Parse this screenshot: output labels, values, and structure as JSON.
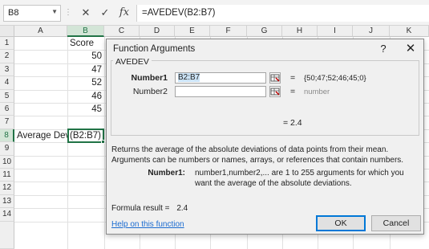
{
  "formula_bar": {
    "name_box": "B8",
    "cancel_glyph": "✕",
    "enter_glyph": "✓",
    "fx_label": "fx",
    "formula": "=AVEDEV(B2:B7)"
  },
  "columns": [
    "A",
    "B",
    "C",
    "D",
    "E",
    "F",
    "G",
    "H",
    "I",
    "J",
    "K"
  ],
  "rows": [
    "1",
    "2",
    "3",
    "4",
    "5",
    "6",
    "7",
    "8",
    "9",
    "10",
    "11",
    "12",
    "13",
    "14"
  ],
  "cells": {
    "b1": "Score",
    "b2": "50",
    "b3": "47",
    "b4": "52",
    "b5": "46",
    "b6": "45",
    "a8": "Average Dev =",
    "b8": "(B2:B7)"
  },
  "dialog": {
    "title": "Function Arguments",
    "help_glyph": "?",
    "close_glyph": "✕",
    "function_name": "AVEDEV",
    "arg1_label": "Number1",
    "arg1_value": "B2:B7",
    "arg1_eq": "=",
    "arg1_result": "{50;47;52;46;45;0}",
    "arg2_label": "Number2",
    "arg2_value": "",
    "arg2_eq": "=",
    "arg2_result": "number",
    "result_line": "=  2.4",
    "description": "Returns the average of the absolute deviations of data points from their mean. Arguments can be numbers or names, arrays, or references that contain numbers.",
    "arg_desc_label": "Number1:",
    "arg_desc": "number1,number2,... are 1 to 255 arguments for which you want the average of the absolute deviations.",
    "formula_result_label": "Formula result =",
    "formula_result_value": "2.4",
    "help_link": "Help on this function",
    "ok_label": "OK",
    "cancel_label": "Cancel"
  },
  "colors": {
    "accent": "#217346",
    "link": "#1a6bd0",
    "ok_border": "#0078d7"
  }
}
